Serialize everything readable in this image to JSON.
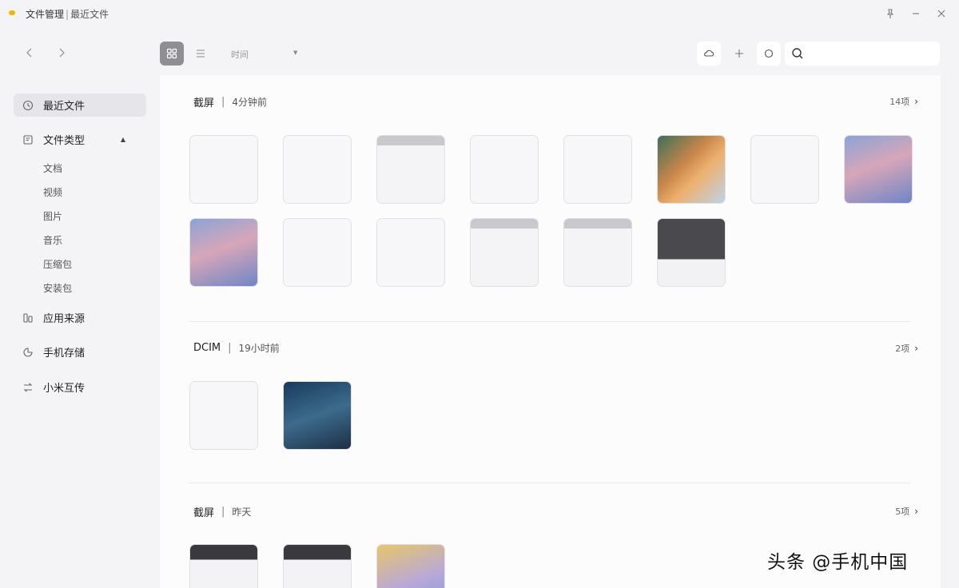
{
  "window": {
    "app_name": "文件管理",
    "separator": "|",
    "page_name": "最近文件",
    "pin_icon": "pin-icon",
    "minimize_icon": "minimize-icon",
    "close_icon": "close-icon"
  },
  "nav": {
    "back_icon": "chevron-left-icon",
    "forward_icon": "chevron-right-icon"
  },
  "sidebar": {
    "items": [
      {
        "label": "最近文件",
        "icon": "clock-icon"
      },
      {
        "label": "文件类型",
        "icon": "file-type-icon"
      },
      {
        "label": "应用来源",
        "icon": "app-source-icon"
      },
      {
        "label": "手机存储",
        "icon": "phone-storage-icon"
      },
      {
        "label": "小米互传",
        "icon": "transfer-icon"
      }
    ],
    "file_types": [
      "文档",
      "视频",
      "图片",
      "音乐",
      "压缩包",
      "安装包"
    ]
  },
  "toolbar": {
    "sort_label": "时间",
    "grid_icon": "grid-view-icon",
    "list_icon": "list-view-icon",
    "cloud_icon": "cloud-icon",
    "add_icon": "plus-icon",
    "refresh_icon": "refresh-icon",
    "search_icon": "search-icon",
    "search_placeholder": ""
  },
  "sections": [
    {
      "source": "截屏",
      "time": "4分钟前",
      "count": "14项"
    },
    {
      "source": "DCIM",
      "time": "19小时前",
      "count": "2项"
    },
    {
      "source": "截屏",
      "time": "昨天",
      "count": "5项"
    }
  ],
  "watermark": "头条 @手机中国"
}
